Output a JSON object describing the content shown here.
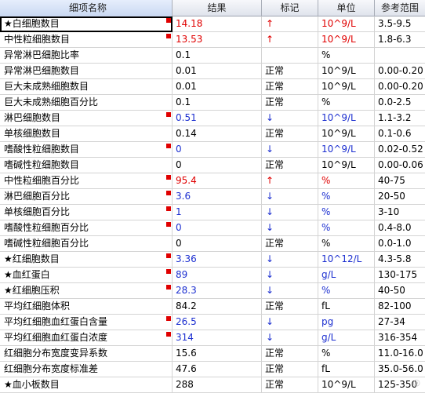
{
  "columns": [
    "细项名称",
    "结果",
    "标记",
    "单位",
    "参考范围"
  ],
  "rows": [
    {
      "name": "★白细胞数目",
      "value": "14.18",
      "mark": "↑",
      "unit": "10^9/L",
      "range": "3.5-9.5",
      "flag": true,
      "color": "red"
    },
    {
      "name": "中性粒细胞数目",
      "value": "13.53",
      "mark": "↑",
      "unit": "10^9/L",
      "range": "1.8-6.3",
      "flag": true,
      "color": "red"
    },
    {
      "name": "异常淋巴细胞比率",
      "value": "0.1",
      "mark": "",
      "unit": "%",
      "range": "",
      "flag": false,
      "color": "black"
    },
    {
      "name": "异常淋巴细胞数目",
      "value": "0.01",
      "mark": "正常",
      "unit": "10^9/L",
      "range": "0.00-0.20",
      "flag": false,
      "color": "black"
    },
    {
      "name": "巨大未成熟细胞数目",
      "value": "0.01",
      "mark": "正常",
      "unit": "10^9/L",
      "range": "0.00-0.20",
      "flag": false,
      "color": "black"
    },
    {
      "name": "巨大未成熟细胞百分比",
      "value": "0.1",
      "mark": "正常",
      "unit": "%",
      "range": "0.0-2.5",
      "flag": false,
      "color": "black"
    },
    {
      "name": "淋巴细胞数目",
      "value": "0.51",
      "mark": "↓",
      "unit": "10^9/L",
      "range": "1.1-3.2",
      "flag": true,
      "color": "blue"
    },
    {
      "name": "单核细胞数目",
      "value": "0.14",
      "mark": "正常",
      "unit": "10^9/L",
      "range": "0.1-0.6",
      "flag": false,
      "color": "black"
    },
    {
      "name": "嗜酸性粒细胞数目",
      "value": "0",
      "mark": "↓",
      "unit": "10^9/L",
      "range": "0.02-0.52",
      "flag": true,
      "color": "blue"
    },
    {
      "name": "嗜碱性粒细胞数目",
      "value": "0",
      "mark": "正常",
      "unit": "10^9/L",
      "range": "0.00-0.06",
      "flag": false,
      "color": "black"
    },
    {
      "name": "中性粒细胞百分比",
      "value": "95.4",
      "mark": "↑",
      "unit": "%",
      "range": "40-75",
      "flag": true,
      "color": "red"
    },
    {
      "name": "淋巴细胞百分比",
      "value": "3.6",
      "mark": "↓",
      "unit": "%",
      "range": "20-50",
      "flag": true,
      "color": "blue"
    },
    {
      "name": "单核细胞百分比",
      "value": "1",
      "mark": "↓",
      "unit": "%",
      "range": "3-10",
      "flag": true,
      "color": "blue"
    },
    {
      "name": "嗜酸性粒细胞百分比",
      "value": "0",
      "mark": "↓",
      "unit": "%",
      "range": "0.4-8.0",
      "flag": true,
      "color": "blue"
    },
    {
      "name": "嗜碱性粒细胞百分比",
      "value": "0",
      "mark": "正常",
      "unit": "%",
      "range": "0.0-1.0",
      "flag": false,
      "color": "black"
    },
    {
      "name": "★红细胞数目",
      "value": "3.36",
      "mark": "↓",
      "unit": "10^12/L",
      "range": "4.3-5.8",
      "flag": true,
      "color": "blue"
    },
    {
      "name": "★血红蛋白",
      "value": "89",
      "mark": "↓",
      "unit": "g/L",
      "range": "130-175",
      "flag": true,
      "color": "blue"
    },
    {
      "name": "★红细胞压积",
      "value": "28.3",
      "mark": "↓",
      "unit": "%",
      "range": "40-50",
      "flag": true,
      "color": "blue"
    },
    {
      "name": "平均红细胞体积",
      "value": "84.2",
      "mark": "正常",
      "unit": "fL",
      "range": "82-100",
      "flag": false,
      "color": "black"
    },
    {
      "name": "平均红细胞血红蛋白含量",
      "value": "26.5",
      "mark": "↓",
      "unit": "pg",
      "range": "27-34",
      "flag": true,
      "color": "blue"
    },
    {
      "name": "平均红细胞血红蛋白浓度",
      "value": "314",
      "mark": "↓",
      "unit": "g/L",
      "range": "316-354",
      "flag": true,
      "color": "blue"
    },
    {
      "name": "红细胞分布宽度变异系数",
      "value": "15.6",
      "mark": "正常",
      "unit": "%",
      "range": "11.0-16.0",
      "flag": false,
      "color": "black"
    },
    {
      "name": "红细胞分布宽度标准差",
      "value": "47.6",
      "mark": "正常",
      "unit": "fL",
      "range": "35.0-56.0",
      "flag": false,
      "color": "black"
    },
    {
      "name": "★血小板数目",
      "value": "288",
      "mark": "正常",
      "unit": "10^9/L",
      "range": "125-350",
      "flag": false,
      "color": "black"
    }
  ],
  "colors": {
    "high": "#e00000",
    "low": "#1c2fd0",
    "normal": "#000000"
  }
}
